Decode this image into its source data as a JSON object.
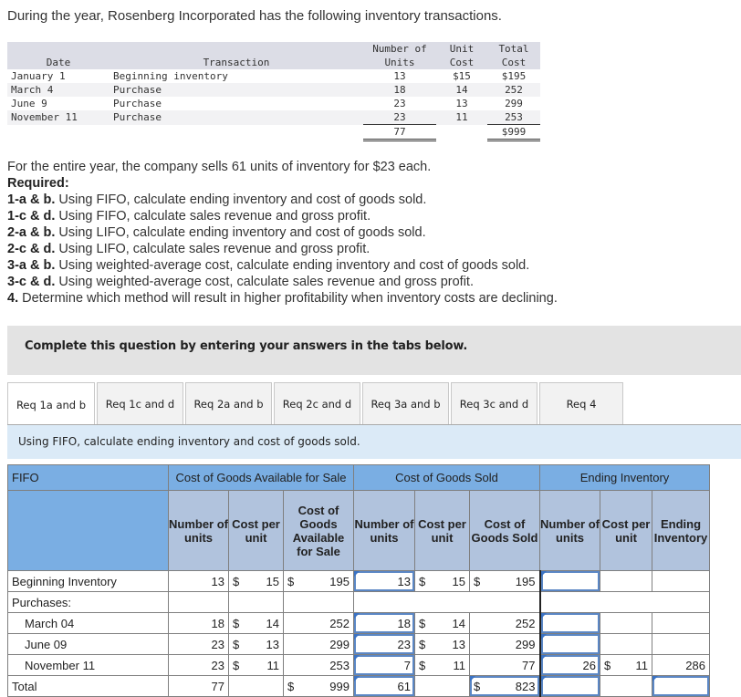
{
  "intro": "During the year, Rosenberg Incorporated has the following inventory transactions.",
  "inventory_table": {
    "headers": {
      "date": "Date",
      "transaction": "Transaction",
      "units_1": "Number of",
      "units_2": "Units",
      "unit_cost_1": "Unit",
      "unit_cost_2": "Cost",
      "total_cost_1": "Total",
      "total_cost_2": "Cost"
    },
    "rows": [
      {
        "date": "January 1",
        "transaction": "Beginning inventory",
        "units": "13",
        "unit_cost": "$15",
        "total_cost": "$195"
      },
      {
        "date": "March 4",
        "transaction": "Purchase",
        "units": "18",
        "unit_cost": "14",
        "total_cost": "252"
      },
      {
        "date": "June 9",
        "transaction": "Purchase",
        "units": "23",
        "unit_cost": "13",
        "total_cost": "299"
      },
      {
        "date": "November 11",
        "transaction": "Purchase",
        "units": "23",
        "unit_cost": "11",
        "total_cost": "253"
      }
    ],
    "total_units": "77",
    "total_cost": "$999"
  },
  "sales_text": "For the entire year, the company sells 61 units of inventory for $23 each.",
  "required_label": "Required:",
  "requirements": [
    {
      "key": "1-a & b.",
      "text": " Using FIFO, calculate ending inventory and cost of goods sold."
    },
    {
      "key": "1-c & d.",
      "text": " Using FIFO, calculate sales revenue and gross profit."
    },
    {
      "key": "2-a & b.",
      "text": " Using LIFO, calculate ending inventory and cost of goods sold."
    },
    {
      "key": "2-c & d.",
      "text": " Using LIFO, calculate sales revenue and gross profit."
    },
    {
      "key": "3-a & b.",
      "text": " Using weighted-average cost, calculate ending inventory and cost of goods sold."
    },
    {
      "key": "3-c & d.",
      "text": " Using weighted-average cost, calculate sales revenue and gross profit."
    },
    {
      "key": "4.",
      "text": " Determine which method will result in higher profitability when inventory costs are declining."
    }
  ],
  "banner": "Complete this question by entering your answers in the tabs below.",
  "tabs": [
    {
      "label": "Req 1a and b",
      "active": true
    },
    {
      "label": "Req 1c and d"
    },
    {
      "label": "Req 2a and b"
    },
    {
      "label": "Req 2c and d"
    },
    {
      "label": "Req 3a and b"
    },
    {
      "label": "Req 3c and d"
    },
    {
      "label": "Req 4"
    }
  ],
  "instruction": "Using FIFO, calculate ending inventory and cost of goods sold.",
  "fifo": {
    "method": "FIFO",
    "groups": {
      "available": "Cost of Goods Available for Sale",
      "cogs": "Cost of Goods Sold",
      "ending": "Ending Inventory"
    },
    "subheaders": {
      "avail_units": "Number of units",
      "avail_cpu": "Cost per unit",
      "avail_total": "Cost of Goods Available for Sale",
      "cogs_units": "Number of units",
      "cogs_cpu": "Cost per unit",
      "cogs_total": "Cost of Goods Sold",
      "end_units": "Number of units",
      "end_cpu": "Cost per unit",
      "end_total": "Ending Inventory"
    },
    "currency": "$",
    "rows": {
      "beginning": {
        "label": "Beginning Inventory",
        "avail_units": "13",
        "avail_cpu": "15",
        "avail_total": "195",
        "cogs_units": "13",
        "cogs_cpu": "15",
        "cogs_total": "195",
        "end_units": "",
        "end_cpu": "",
        "end_total": ""
      },
      "purchases_label": "Purchases:",
      "march": {
        "label": "March 04",
        "avail_units": "18",
        "avail_cpu": "14",
        "avail_total": "252",
        "cogs_units": "18",
        "cogs_cpu": "14",
        "cogs_total": "252",
        "end_units": "",
        "end_cpu": "",
        "end_total": ""
      },
      "june": {
        "label": "June 09",
        "avail_units": "23",
        "avail_cpu": "13",
        "avail_total": "299",
        "cogs_units": "23",
        "cogs_cpu": "13",
        "cogs_total": "299",
        "end_units": "",
        "end_cpu": "",
        "end_total": ""
      },
      "november": {
        "label": "November 11",
        "avail_units": "23",
        "avail_cpu": "11",
        "avail_total": "253",
        "cogs_units": "7",
        "cogs_cpu": "11",
        "cogs_total": "77",
        "end_units": "26",
        "end_cpu": "11",
        "end_total": "286"
      },
      "total": {
        "label": "Total",
        "avail_units": "77",
        "avail_total": "999",
        "cogs_units": "61",
        "cogs_total": "823",
        "end_units": "",
        "end_total": ""
      }
    }
  }
}
